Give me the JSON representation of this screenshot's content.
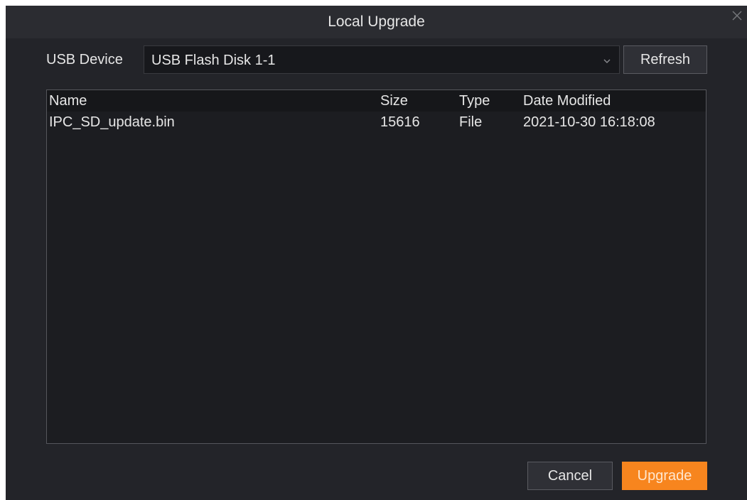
{
  "dialog": {
    "title": "Local Upgrade",
    "close_icon": "close-icon"
  },
  "device": {
    "label": "USB Device",
    "selected": "USB Flash Disk 1-1",
    "dropdown_icon": "chevron-down-icon",
    "refresh_label": "Refresh"
  },
  "table": {
    "columns": {
      "name": "Name",
      "size": "Size",
      "type": "Type",
      "date": "Date Modified"
    },
    "rows": [
      {
        "name": "IPC_SD_update.bin",
        "size": "15616",
        "type": "File",
        "date": "2021-10-30 16:18:08"
      }
    ]
  },
  "actions": {
    "cancel_label": "Cancel",
    "upgrade_label": "Upgrade"
  },
  "colors": {
    "background": "#232429",
    "accent": "#f7851e",
    "text": "#e6e6e6"
  }
}
